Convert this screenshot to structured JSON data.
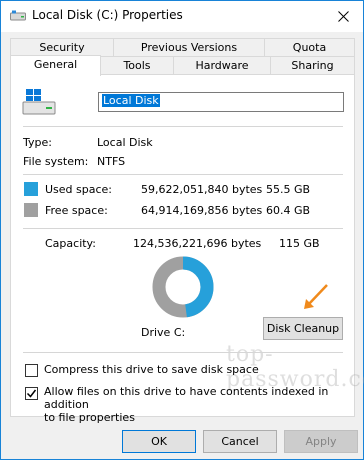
{
  "window": {
    "title": "Local Disk (C:) Properties"
  },
  "tabs": {
    "row_back": [
      "Security",
      "Previous Versions",
      "Quota"
    ],
    "row_front": [
      "General",
      "Tools",
      "Hardware",
      "Sharing"
    ],
    "active": "General"
  },
  "general": {
    "drive_name": "Local Disk",
    "type_label": "Type:",
    "type_value": "Local Disk",
    "fs_label": "File system:",
    "fs_value": "NTFS",
    "used_label": "Used space:",
    "used_bytes": "59,622,051,840 bytes",
    "used_gb": "55.5 GB",
    "free_label": "Free space:",
    "free_bytes": "64,914,169,856 bytes",
    "free_gb": "60.4 GB",
    "capacity_label": "Capacity:",
    "capacity_bytes": "124,536,221,696 bytes",
    "capacity_gb": "115 GB",
    "drive_label": "Drive C:",
    "used_fraction": 0.4787,
    "used_color": "#26a0da",
    "free_color": "#a0a0a0",
    "cleanup_button": "Disk Cleanup",
    "compress_label": "Compress this drive to save disk space",
    "compress_checked": false,
    "index_label_line1": "Allow files on this drive to have contents indexed in addition",
    "index_label_line2": "to file properties",
    "index_checked": true
  },
  "watermark": "top-password.com",
  "buttons": {
    "ok": "OK",
    "cancel": "Cancel",
    "apply": "Apply"
  }
}
